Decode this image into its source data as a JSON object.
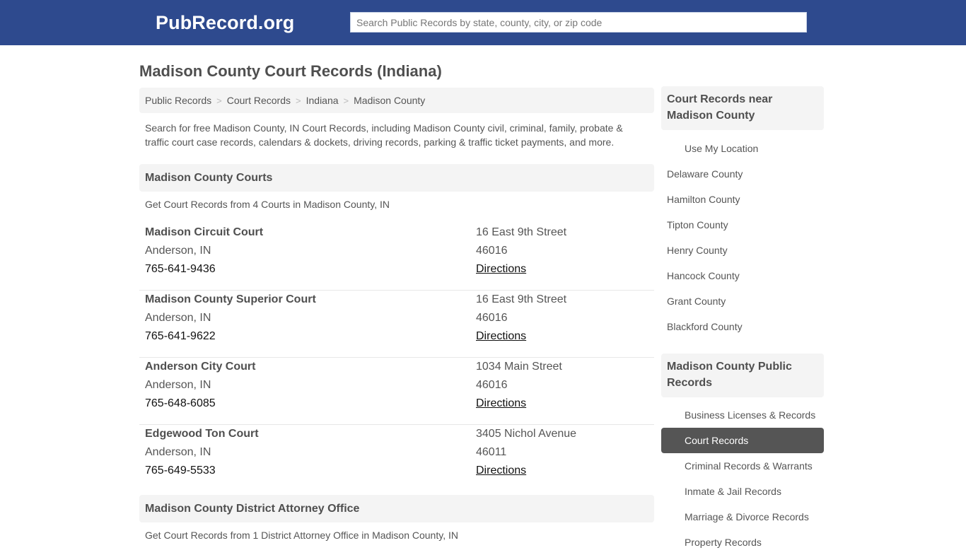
{
  "header": {
    "logo": "PubRecord.org",
    "search_placeholder": "Search Public Records by state, county, city, or zip code",
    "brand_color": "#2e4a8e"
  },
  "page": {
    "title": "Madison County Court Records (Indiana)",
    "breadcrumb": [
      {
        "label": "Public Records"
      },
      {
        "label": "Court Records"
      },
      {
        "label": "Indiana"
      },
      {
        "label": "Madison County"
      }
    ],
    "breadcrumb_separator": ">",
    "intro": "Search for free Madison County, IN Court Records, including Madison County civil, criminal, family, probate & traffic court case records, calendars & dockets, driving records, parking & traffic ticket payments, and more."
  },
  "courts_section": {
    "heading": "Madison County Courts",
    "subheading": "Get Court Records from 4 Courts in Madison County, IN",
    "courts": [
      {
        "name": "Madison Circuit Court",
        "city": "Anderson, IN",
        "phone": "765-641-9436",
        "address": "16 East 9th Street",
        "zip": "46016",
        "directions": "Directions"
      },
      {
        "name": "Madison County Superior Court",
        "city": "Anderson, IN",
        "phone": "765-641-9622",
        "address": "16 East 9th Street",
        "zip": "46016",
        "directions": "Directions"
      },
      {
        "name": "Anderson City Court",
        "city": "Anderson, IN",
        "phone": "765-648-6085",
        "address": "1034 Main Street",
        "zip": "46016",
        "directions": "Directions"
      },
      {
        "name": "Edgewood Ton Court",
        "city": "Anderson, IN",
        "phone": "765-649-5533",
        "address": "3405 Nichol Avenue",
        "zip": "46011",
        "directions": "Directions"
      }
    ]
  },
  "da_section": {
    "heading": "Madison County District Attorney Office",
    "subheading": "Get Court Records from 1 District Attorney Office in Madison County, IN"
  },
  "sidebar": {
    "nearby": {
      "heading": "Court Records near Madison County",
      "use_location": "Use My Location",
      "counties": [
        "Delaware County",
        "Hamilton County",
        "Tipton County",
        "Henry County",
        "Hancock County",
        "Grant County",
        "Blackford County"
      ]
    },
    "public_records": {
      "heading": "Madison County Public Records",
      "items": [
        {
          "label": "Business Licenses & Records",
          "active": false
        },
        {
          "label": "Court Records",
          "active": true
        },
        {
          "label": "Criminal Records & Warrants",
          "active": false
        },
        {
          "label": "Inmate & Jail Records",
          "active": false
        },
        {
          "label": "Marriage & Divorce Records",
          "active": false
        },
        {
          "label": "Property Records",
          "active": false
        }
      ]
    }
  }
}
